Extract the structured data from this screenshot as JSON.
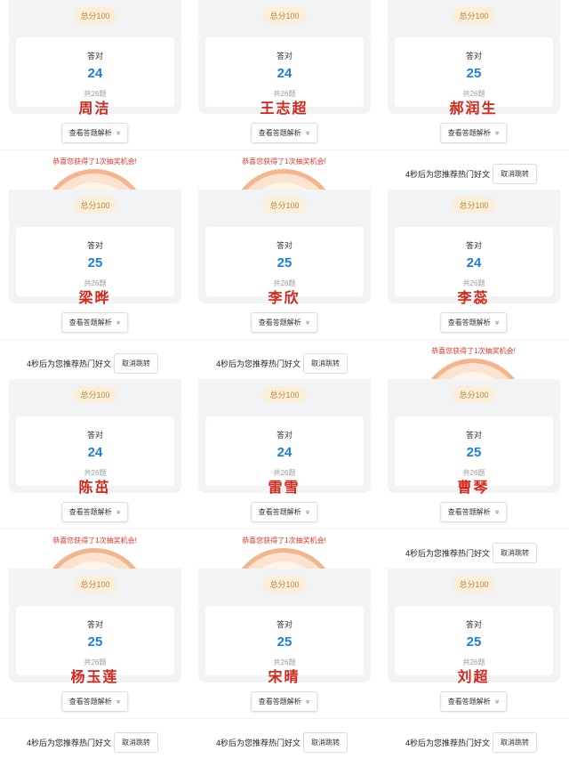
{
  "common": {
    "score_label": "总分100",
    "correct_label": "答对",
    "total_label": "共26题",
    "review_label": "查看答题解析",
    "review_icon": "chevron-double-down-icon",
    "lottery_text": "恭喜您获得了1次抽奖机会!",
    "redirect_text": "4秒后为您推荐热门好文",
    "cancel_label": "取消跳转"
  },
  "tiles": [
    {
      "name": "周洁",
      "correct": "24",
      "footer": "lottery"
    },
    {
      "name": "王志超",
      "correct": "24",
      "footer": "lottery"
    },
    {
      "name": "郝润生",
      "correct": "25",
      "footer": "redirect"
    },
    {
      "name": "梁晔",
      "correct": "25",
      "footer": "redirect"
    },
    {
      "name": "李欣",
      "correct": "25",
      "footer": "redirect"
    },
    {
      "name": "李蕊",
      "correct": "24",
      "footer": "lottery"
    },
    {
      "name": "陈茁",
      "correct": "24",
      "footer": "lottery"
    },
    {
      "name": "雷雪",
      "correct": "24",
      "footer": "lottery"
    },
    {
      "name": "曹琴",
      "correct": "25",
      "footer": "redirect"
    },
    {
      "name": "杨玉莲",
      "correct": "25",
      "footer": "redirect"
    },
    {
      "name": "宋晴",
      "correct": "25",
      "footer": "redirect"
    },
    {
      "name": "刘超",
      "correct": "25",
      "footer": "redirect"
    }
  ],
  "colors": {
    "value_blue": "#1a7fe0",
    "stamp_red": "#d6261a",
    "badge_bg": "#fbefd9",
    "lottery_red": "#e4352b"
  }
}
